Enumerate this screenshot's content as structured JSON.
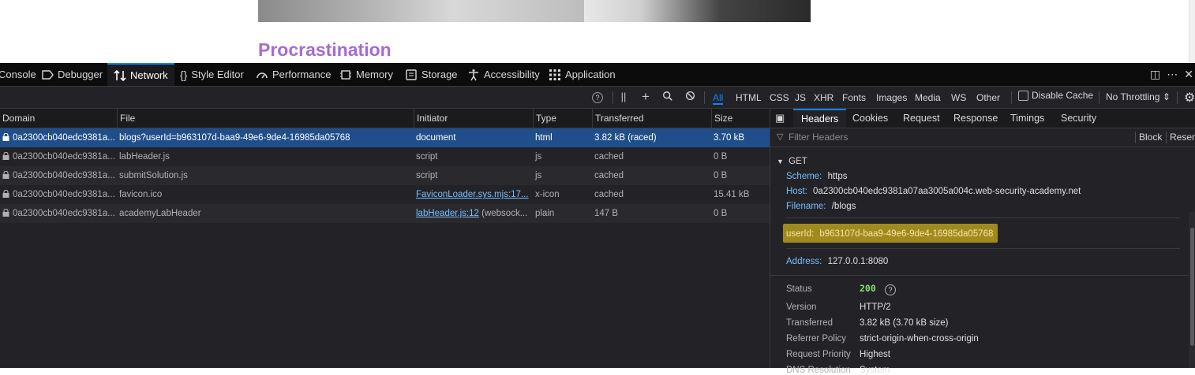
{
  "page": {
    "post_title": "Procrastination",
    "more_icon": "⋮"
  },
  "devtools": {
    "tabs": [
      {
        "label": "Console",
        "icon": "console-icon"
      },
      {
        "label": "Debugger",
        "icon": "debugger-icon"
      },
      {
        "label": "Network",
        "icon": "network-icon",
        "active": true
      },
      {
        "label": "Style Editor",
        "icon": "style-editor-icon"
      },
      {
        "label": "Performance",
        "icon": "performance-icon"
      },
      {
        "label": "Memory",
        "icon": "memory-icon"
      },
      {
        "label": "Storage",
        "icon": "storage-icon"
      },
      {
        "label": "Accessibility",
        "icon": "accessibility-icon"
      },
      {
        "label": "Application",
        "icon": "application-icon"
      }
    ],
    "toolbar": {
      "filters": [
        "All",
        "HTML",
        "CSS",
        "JS",
        "XHR",
        "Fonts",
        "Images",
        "Media",
        "WS",
        "Other"
      ],
      "active_filter": "All",
      "disable_cache": "Disable Cache",
      "throttling": "No Throttling ⇕",
      "pause_icon": "||",
      "add_icon": "+",
      "help_icon": "?"
    },
    "table": {
      "headers": [
        "Domain",
        "File",
        "Initiator",
        "Type",
        "Transferred",
        "Size"
      ],
      "rows": [
        {
          "domain": "0a2300cb040edc9381a...",
          "file": "blogs?userId=b963107d-baa9-49e6-9de4-16985da05768",
          "initiator": "document",
          "initiator_link": false,
          "initiator_extra": "",
          "type": "html",
          "transferred": "3.82 kB (raced)",
          "size": "3.70 kB",
          "selected": true
        },
        {
          "domain": "0a2300cb040edc9381a...",
          "file": "labHeader.js",
          "initiator": "script",
          "initiator_link": false,
          "initiator_extra": "",
          "type": "js",
          "transferred": "cached",
          "size": "0 B"
        },
        {
          "domain": "0a2300cb040edc9381a...",
          "file": "submitSolution.js",
          "initiator": "script",
          "initiator_link": false,
          "initiator_extra": "",
          "type": "js",
          "transferred": "cached",
          "size": "0 B"
        },
        {
          "domain": "0a2300cb040edc9381a...",
          "file": "favicon.ico",
          "initiator": "FaviconLoader.sys.mjs:17...",
          "initiator_link": true,
          "initiator_extra": "",
          "type": "x-icon",
          "transferred": "cached",
          "size": "15.41 kB"
        },
        {
          "domain": "0a2300cb040edc9381a...",
          "file": "academyLabHeader",
          "initiator": "labHeader.js:12",
          "initiator_link": true,
          "initiator_extra": " (websock...",
          "type": "plain",
          "transferred": "147 B",
          "size": "0 B"
        }
      ]
    },
    "details": {
      "tabs": [
        "Headers",
        "Cookies",
        "Request",
        "Response",
        "Timings",
        "Security"
      ],
      "active_tab": "Headers",
      "filter_placeholder": "Filter Headers",
      "block_label": "Block",
      "resend_label": "Resend",
      "method": "GET",
      "scheme_label": "Scheme:",
      "scheme": "https",
      "host_label": "Host:",
      "host": "0a2300cb040edc9381a07aa3005a004c.web-security-academy.net",
      "filename_label": "Filename:",
      "filename": "/blogs",
      "param_label": "userId:",
      "param_value": "b963107d-baa9-49e6-9de4-16985da05768",
      "address_label": "Address:",
      "address": "127.0.0.1:8080",
      "status_label": "Status",
      "status": "200",
      "version_label": "Version",
      "version": "HTTP/2",
      "transferred_label": "Transferred",
      "transferred": "3.82 kB (3.70 kB size)",
      "referrer_label": "Referrer Policy",
      "referrer": "strict-origin-when-cross-origin",
      "priority_label": "Request Priority",
      "priority": "Highest",
      "dns_label": "DNS Resolution",
      "dns": "System"
    }
  }
}
